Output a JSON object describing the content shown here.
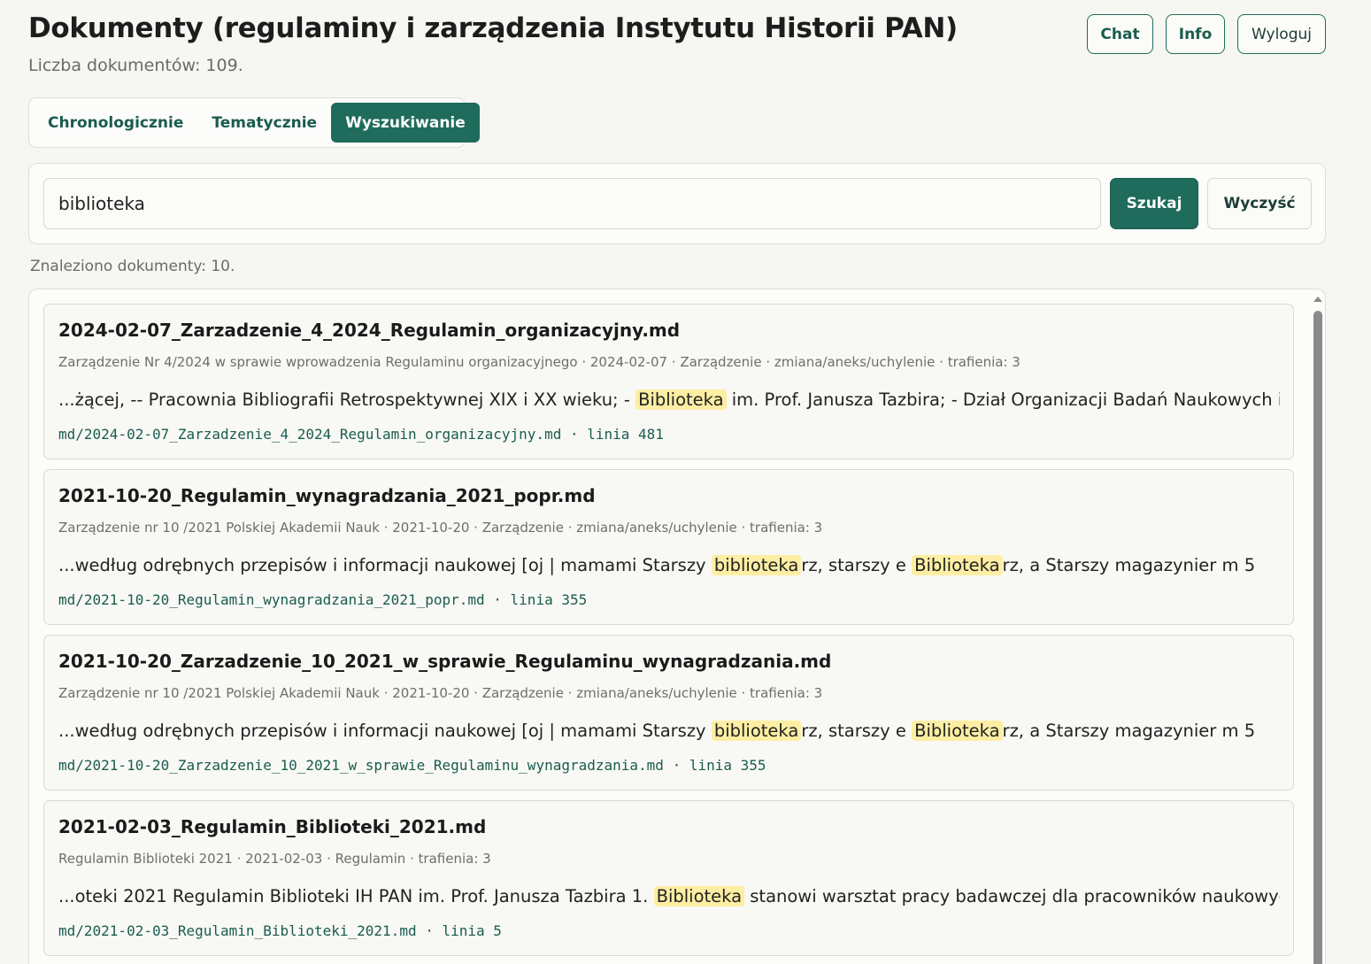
{
  "header": {
    "title": "Dokumenty (regulaminy i zarządzenia Instytutu Historii PAN)",
    "count": "Liczba dokumentów: 109."
  },
  "top_buttons": {
    "chat": "Chat",
    "info": "Info",
    "logout": "Wyloguj"
  },
  "tabs": [
    {
      "label": "Chronologicznie",
      "active": false
    },
    {
      "label": "Tematycznie",
      "active": false
    },
    {
      "label": "Wyszukiwanie",
      "active": true
    }
  ],
  "search": {
    "value": "biblioteka",
    "submit_label": "Szukaj",
    "clear_label": "Wyczyść"
  },
  "found_text": "Znaleziono dokumenty: 10.",
  "results": [
    {
      "title": "2024-02-07_Zarzadzenie_4_2024_Regulamin_organizacyjny.md",
      "meta": "Zarządzenie Nr 4/2024 w sprawie wprowadzenia Regulaminu organizacyjnego · 2024-02-07 · Zarządzenie · zmiana/aneks/uchylenie · trafienia: 3",
      "snippet": {
        "pre": "...żącej, -- Pracownia Bibliografii Retrospektywnej XIX i XX wieku; - ",
        "hl1": "Biblioteka",
        "mid": " im. Prof. Janusza Tazbira; - Dział Organizacji Badań Naukowych i",
        "hl2": "",
        "post": ""
      },
      "path": "md/2024-02-07_Zarzadzenie_4_2024_Regulamin_organizacyjny.md · linia 481"
    },
    {
      "title": "2021-10-20_Regulamin_wynagradzania_2021_popr.md",
      "meta": "Zarządzenie nr 10 /2021 Polskiej Akademii Nauk · 2021-10-20 · Zarządzenie · zmiana/aneks/uchylenie · trafienia: 3",
      "snippet": {
        "pre": "...według odrębnych przepisów i informacji naukowej [oj | mamami Starszy ",
        "hl1": "biblioteka",
        "mid": "rz, starszy e ",
        "hl2": "Biblioteka",
        "post": "rz, a Starszy magazynier m 5"
      },
      "path": "md/2021-10-20_Regulamin_wynagradzania_2021_popr.md · linia 355"
    },
    {
      "title": "2021-10-20_Zarzadzenie_10_2021_w_sprawie_Regulaminu_wynagradzania.md",
      "meta": "Zarządzenie nr 10 /2021 Polskiej Akademii Nauk · 2021-10-20 · Zarządzenie · zmiana/aneks/uchylenie · trafienia: 3",
      "snippet": {
        "pre": "...według odrębnych przepisów i informacji naukowej [oj | mamami Starszy ",
        "hl1": "biblioteka",
        "mid": "rz, starszy e ",
        "hl2": "Biblioteka",
        "post": "rz, a Starszy magazynier m 5"
      },
      "path": "md/2021-10-20_Zarzadzenie_10_2021_w_sprawie_Regulaminu_wynagradzania.md · linia 355"
    },
    {
      "title": "2021-02-03_Regulamin_Biblioteki_2021.md",
      "meta": "Regulamin Biblioteki 2021 · 2021-02-03 · Regulamin · trafienia: 3",
      "snippet": {
        "pre": "...oteki 2021 Regulamin Biblioteki IH PAN im. Prof. Janusza Tazbira 1. ",
        "hl1": "Biblioteka",
        "mid": " stanowi warsztat pracy badawczej dla pracowników naukowych,",
        "hl2": "",
        "post": ""
      },
      "path": "md/2021-02-03_Regulamin_Biblioteki_2021.md · linia 5"
    }
  ],
  "icons": {
    "scroll_up": "scroll-up-arrow-icon"
  },
  "colors": {
    "accent": "#1f6b5c",
    "highlight": "#fdeea3",
    "background": "#f6f6f2"
  }
}
